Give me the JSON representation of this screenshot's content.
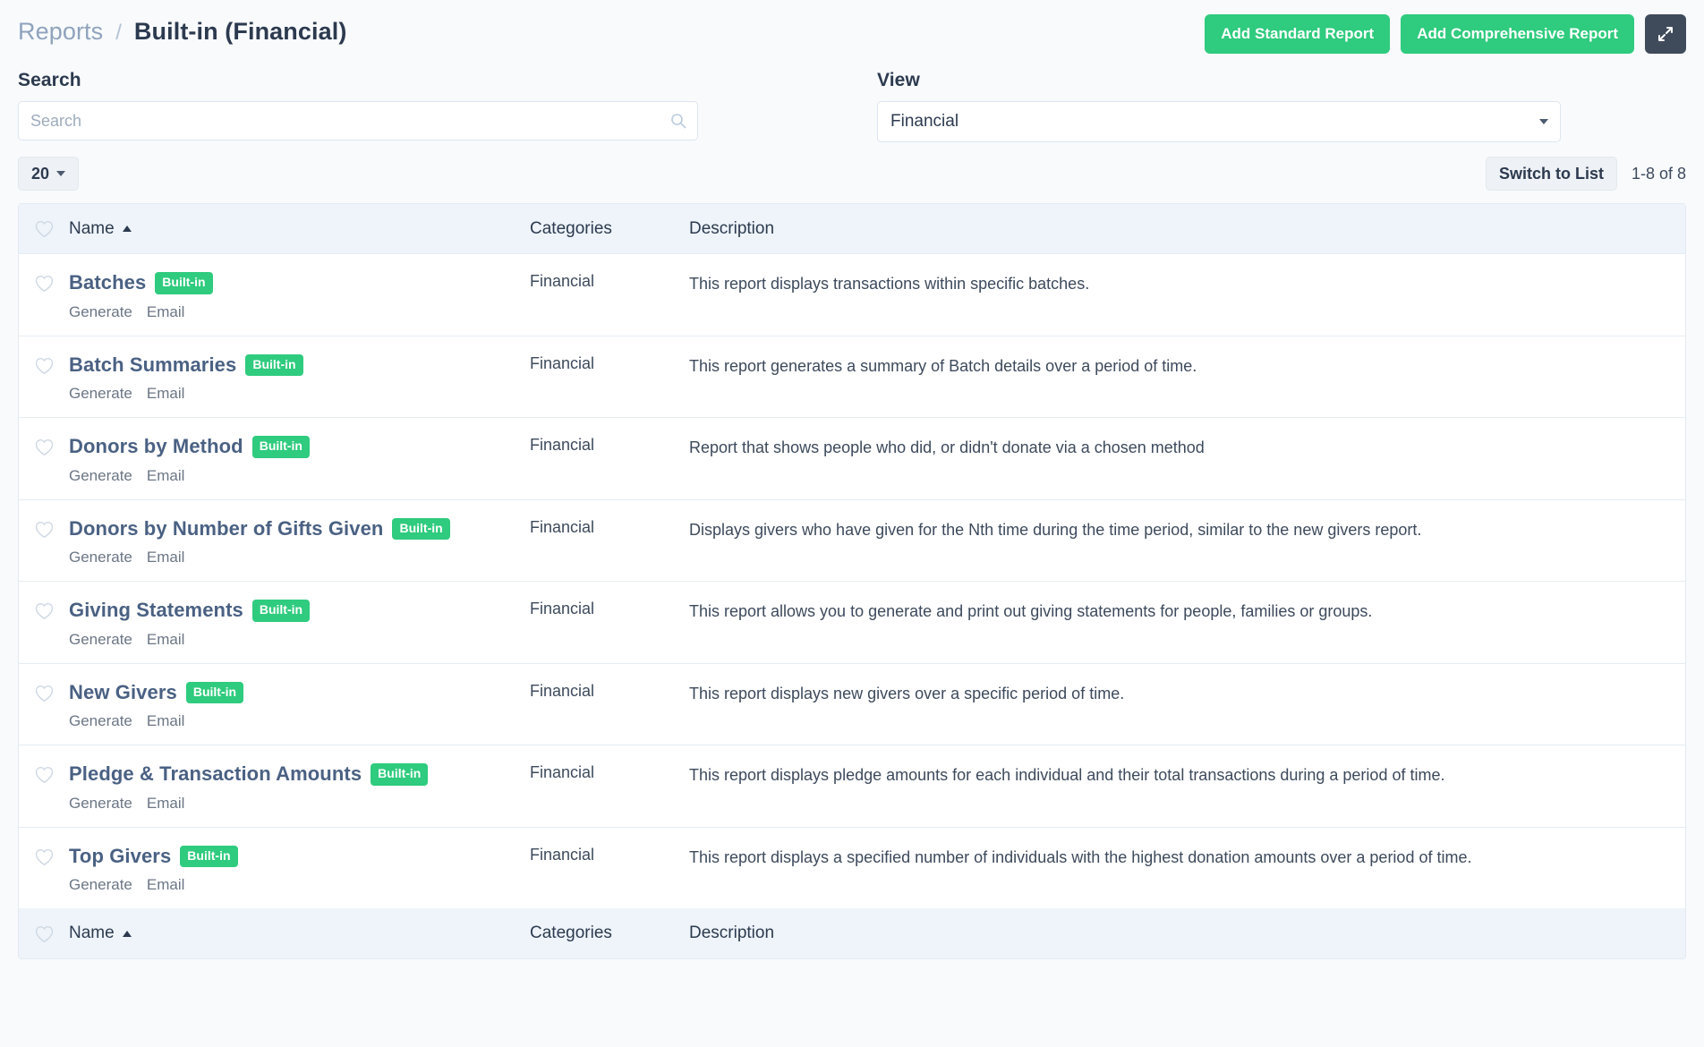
{
  "header": {
    "breadcrumb_parent": "Reports",
    "breadcrumb_separator": "/",
    "breadcrumb_current": "Built-in (Financial)",
    "add_standard_label": "Add Standard Report",
    "add_comprehensive_label": "Add Comprehensive Report",
    "expand_icon": "expand-icon",
    "accent_green": "#2fcb7e",
    "dark_button": "#3f4a5a"
  },
  "filters": {
    "search_label": "Search",
    "search_value": "",
    "search_placeholder": "Search",
    "search_icon": "search-icon",
    "view_label": "View",
    "view_value": "Financial",
    "view_options": [
      "Financial"
    ]
  },
  "toolbar": {
    "page_size": "20",
    "switch_view_label": "Switch to List",
    "result_count": "1-8 of 8"
  },
  "table": {
    "columns": {
      "favorite": "",
      "name": "Name",
      "categories": "Categories",
      "description": "Description"
    },
    "sort_column": "Name",
    "sort_direction": "asc",
    "action_generate": "Generate",
    "action_email": "Email",
    "badge_label": "Built-in",
    "rows": [
      {
        "name": "Batches",
        "badge": "Built-in",
        "category": "Financial",
        "description": "This report displays transactions within specific batches."
      },
      {
        "name": "Batch Summaries",
        "badge": "Built-in",
        "category": "Financial",
        "description": "This report generates a summary of Batch details over a period of time."
      },
      {
        "name": "Donors by Method",
        "badge": "Built-in",
        "category": "Financial",
        "description": "Report that shows people who did, or didn't donate via a chosen method"
      },
      {
        "name": "Donors by Number of Gifts Given",
        "badge": "Built-in",
        "category": "Financial",
        "description": "Displays givers who have given for the Nth time during the time period, similar to the new givers report."
      },
      {
        "name": "Giving Statements",
        "badge": "Built-in",
        "category": "Financial",
        "description": "This report allows you to generate and print out giving statements for people, families or groups."
      },
      {
        "name": "New Givers",
        "badge": "Built-in",
        "category": "Financial",
        "description": "This report displays new givers over a specific period of time."
      },
      {
        "name": "Pledge & Transaction Amounts",
        "badge": "Built-in",
        "category": "Financial",
        "description": "This report displays pledge amounts for each individual and their total transactions during a period of time."
      },
      {
        "name": "Top Givers",
        "badge": "Built-in",
        "category": "Financial",
        "description": "This report displays a specified number of individuals with the highest donation amounts over a period of time."
      }
    ]
  }
}
